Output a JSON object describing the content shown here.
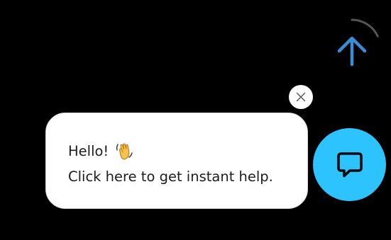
{
  "scroll_top": {
    "icon": "arrow-up-icon",
    "progress": 0.18,
    "arrow_color": "#3d8bd4",
    "ring_color": "#555555"
  },
  "greeting": {
    "line1": "Hello!",
    "line1_icon": "waving-hand-icon",
    "line2": "Click here to get instant help."
  },
  "close_button": {
    "icon": "close-icon"
  },
  "chat_launcher": {
    "icon": "chat-bubble-icon",
    "color": "#2cc3ff"
  }
}
